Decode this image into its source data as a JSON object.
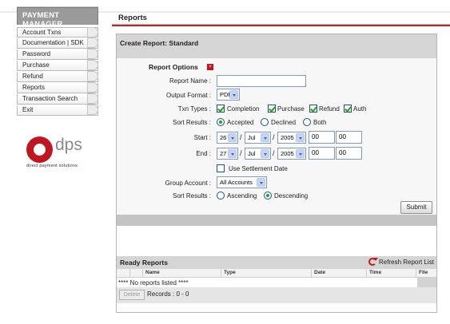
{
  "app": {
    "brand": "PAYMENT MANAGER",
    "section": "Reports",
    "accent": "#c01622"
  },
  "sidebar": {
    "items": [
      {
        "label": "Account Txns"
      },
      {
        "label": "Documentation | SDK"
      },
      {
        "label": "Password"
      },
      {
        "label": "Purchase"
      },
      {
        "label": "Refund"
      },
      {
        "label": "Reports"
      },
      {
        "label": "Transaction Search"
      },
      {
        "label": "Exit"
      }
    ]
  },
  "logo": {
    "text": "dps",
    "sub": "direct payment solutions"
  },
  "panel": {
    "title": "Create Report: Standard",
    "options_title": "Report Options",
    "options_toggle_icon": "collapse-icon",
    "fields": {
      "report_name": {
        "label": "Report Name :",
        "value": ""
      },
      "output_format": {
        "label": "Output Format :",
        "value": "PDF"
      },
      "txn_types": {
        "label": "Txn Types :",
        "options": [
          {
            "label": "Completion",
            "checked": true
          },
          {
            "label": "Purchase",
            "checked": true
          },
          {
            "label": "Refund",
            "checked": true
          },
          {
            "label": "Auth",
            "checked": true
          }
        ]
      },
      "sort_results_status": {
        "label": "Sort Results :",
        "options": [
          {
            "label": "Accepted",
            "selected": true
          },
          {
            "label": "Declined",
            "selected": false
          },
          {
            "label": "Both",
            "selected": false
          }
        ]
      },
      "start": {
        "label": "Start :",
        "day": "26",
        "month": "Jul",
        "year": "2005",
        "hour": "00",
        "minute": "00",
        "sep": "/"
      },
      "end": {
        "label": "End :",
        "day": "27",
        "month": "Jul",
        "year": "2005",
        "hour": "00",
        "minute": "00",
        "sep": "/"
      },
      "use_settlement_date": {
        "label": "Use Settlement Date",
        "checked": false
      },
      "group_account": {
        "label": "Group Account :",
        "value": "All Accounts"
      },
      "sort_results_order": {
        "label": "Sort Results :",
        "options": [
          {
            "label": "Ascending",
            "selected": false
          },
          {
            "label": "Descending",
            "selected": true
          }
        ]
      }
    },
    "submit_label": "Submit"
  },
  "ready_reports": {
    "title": "Ready Reports",
    "refresh_label": "Refresh Report List",
    "columns": [
      "Name",
      "Type",
      "Date",
      "Time",
      "File"
    ],
    "empty_text": "**** No reports listed ****",
    "delete_label": "Delete",
    "records_text": "Records : 0 - 0"
  }
}
